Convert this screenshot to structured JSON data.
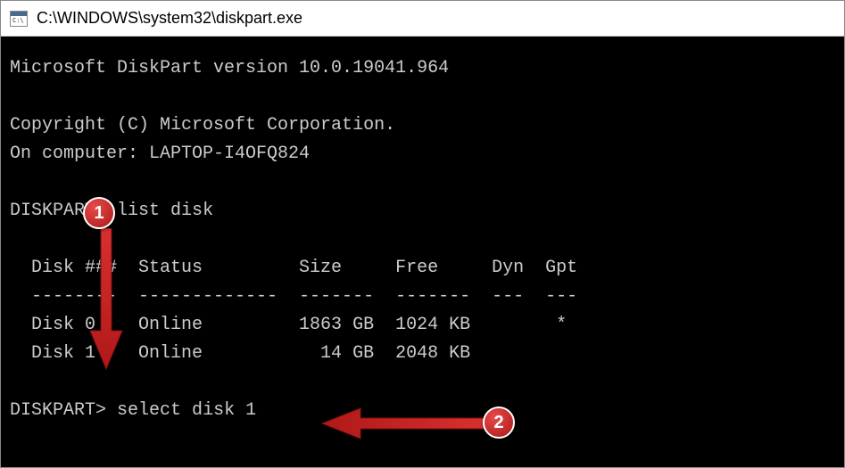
{
  "titlebar": {
    "title": "C:\\WINDOWS\\system32\\diskpart.exe"
  },
  "console": {
    "header_version": "Microsoft DiskPart version 10.0.19041.964",
    "copyright": "Copyright (C) Microsoft Corporation.",
    "computer": "On computer: LAPTOP-I4OFQ824",
    "prompt1": "DISKPART>",
    "command1": "list disk",
    "table_header": "  Disk ###  Status         Size     Free     Dyn  Gpt",
    "table_divider": "  --------  -------------  -------  -------  ---  ---",
    "table_row0": "  Disk 0    Online         1863 GB  1024 KB        *",
    "table_row1": "  Disk 1    Online           14 GB  2048 KB",
    "prompt2": "DISKPART>",
    "command2": "select disk 1"
  },
  "annotations": {
    "badge1": "1",
    "badge2": "2"
  },
  "chart_data": {
    "type": "table",
    "title": "DISKPART list disk",
    "columns": [
      "Disk ###",
      "Status",
      "Size",
      "Free",
      "Dyn",
      "Gpt"
    ],
    "rows": [
      {
        "Disk ###": "Disk 0",
        "Status": "Online",
        "Size": "1863 GB",
        "Free": "1024 KB",
        "Dyn": "",
        "Gpt": "*"
      },
      {
        "Disk ###": "Disk 1",
        "Status": "Online",
        "Size": "14 GB",
        "Free": "2048 KB",
        "Dyn": "",
        "Gpt": ""
      }
    ]
  }
}
